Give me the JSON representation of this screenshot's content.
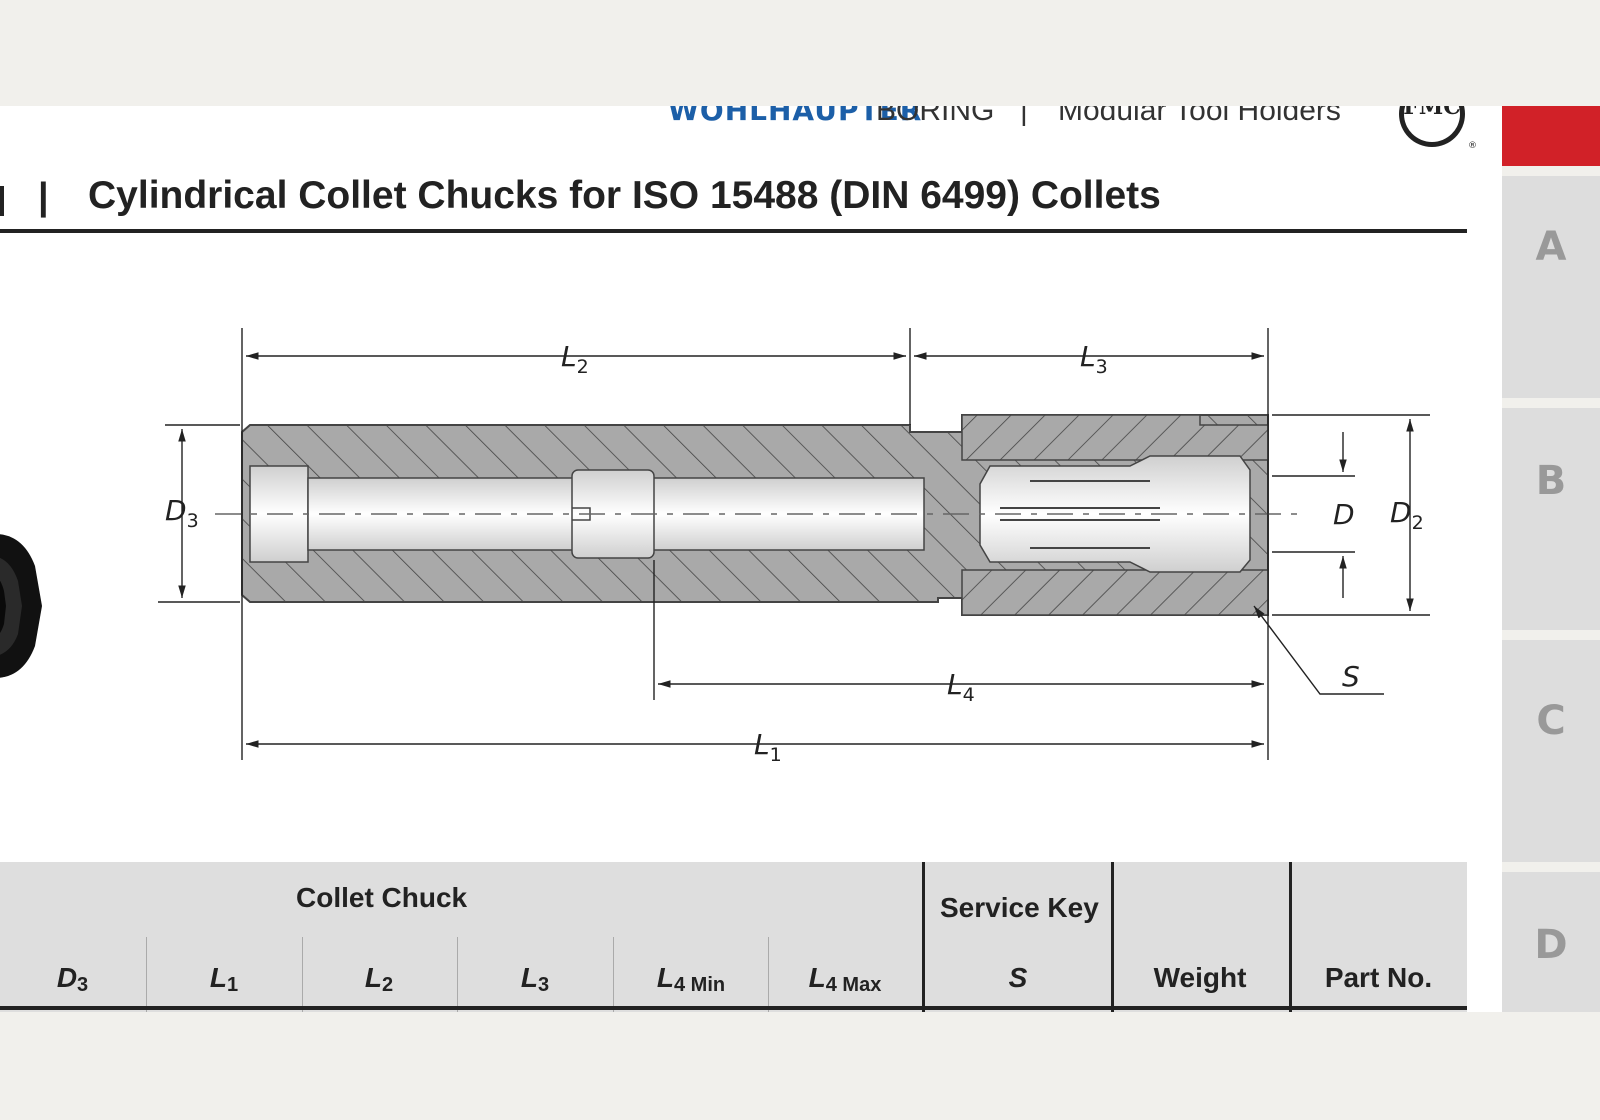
{
  "header": {
    "brand_logo": "WOHLHAUPTER",
    "section": "BORING",
    "separator": "|",
    "subsection": "Modular Tool Holders",
    "fmc_logo_alt": "FMC"
  },
  "title": {
    "separator": "|",
    "text": "Cylindrical Collet Chucks for ISO 15488 (DIN 6499) Collets"
  },
  "tabs": [
    {
      "label": "A"
    },
    {
      "label": "B"
    },
    {
      "label": "C"
    },
    {
      "label": "D"
    }
  ],
  "colors": {
    "accent_red": "#d12128",
    "brand_blue": "#1c5fa8",
    "tab_gray": "#dddddd"
  },
  "drawing": {
    "labels": {
      "l1": "L",
      "l1_sub": "1",
      "l2": "L",
      "l2_sub": "2",
      "l3": "L",
      "l3_sub": "3",
      "l4": "L",
      "l4_sub": "4",
      "d": "D",
      "d2": "D",
      "d2_sub": "2",
      "d3": "D",
      "d3_sub": "3",
      "s": "S"
    }
  },
  "table": {
    "group_collet_chuck": "Collet Chuck",
    "group_service_key": "Service Key",
    "columns": [
      {
        "main": "D",
        "sub": "3"
      },
      {
        "main": "L",
        "sub": "1"
      },
      {
        "main": "L",
        "sub": "2"
      },
      {
        "main": "L",
        "sub": "3"
      },
      {
        "main": "L",
        "sub": "4 Min"
      },
      {
        "main": "L",
        "sub": "4 Max"
      }
    ],
    "service_key_col": "S",
    "weight": "Weight",
    "part_no": "Part No."
  }
}
